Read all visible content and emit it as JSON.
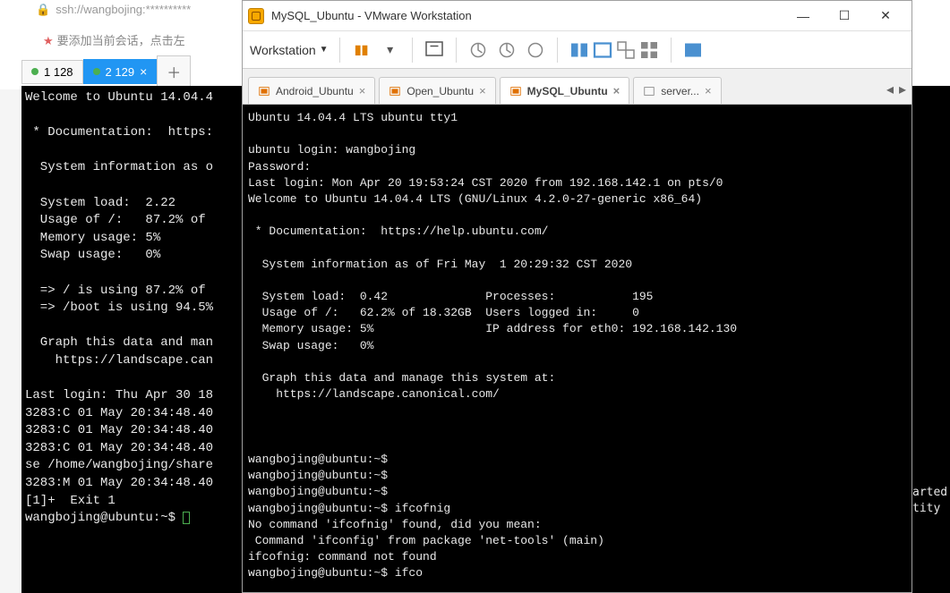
{
  "browser": {
    "address": "ssh://wangbojing:**********",
    "note": "要添加当前会话，点击左",
    "tabs": [
      {
        "label": "1 128"
      },
      {
        "label": "2 129"
      }
    ]
  },
  "left_terminal": {
    "lines": "Welcome to Ubuntu 14.04.4\n\n * Documentation:  https:\n\n  System information as o\n\n  System load:  2.22\n  Usage of /:   87.2% of \n  Memory usage: 5%\n  Swap usage:   0%\n\n  => / is using 87.2% of \n  => /boot is using 94.5%\n\n  Graph this data and man\n    https://landscape.can\n\nLast login: Thu Apr 30 18\n3283:C 01 May 20:34:48.40\n3283:C 01 May 20:34:48.40\n3283:C 01 May 20:34:48.40\nse /home/wangbojing/share\n3283:M 01 May 20:34:48.40\n[1]+  Exit 1\nwangbojing@ubuntu:~$ "
  },
  "right_terminal": {
    "lines": "arted\ntity"
  },
  "vmware": {
    "title": "MySQL_Ubuntu - VMware Workstation",
    "menu_label": "Workstation",
    "tabs": [
      {
        "label": "Android_Ubuntu"
      },
      {
        "label": "Open_Ubuntu"
      },
      {
        "label": "MySQL_Ubuntu"
      },
      {
        "label": "server..."
      }
    ],
    "terminal_lines": "Ubuntu 14.04.4 LTS ubuntu tty1\n\nubuntu login: wangbojing\nPassword:\nLast login: Mon Apr 20 19:53:24 CST 2020 from 192.168.142.1 on pts/0\nWelcome to Ubuntu 14.04.4 LTS (GNU/Linux 4.2.0-27-generic x86_64)\n\n * Documentation:  https://help.ubuntu.com/\n\n  System information as of Fri May  1 20:29:32 CST 2020\n\n  System load:  0.42              Processes:           195\n  Usage of /:   62.2% of 18.32GB  Users logged in:     0\n  Memory usage: 5%                IP address for eth0: 192.168.142.130\n  Swap usage:   0%\n\n  Graph this data and manage this system at:\n    https://landscape.canonical.com/\n\n\n\nwangbojing@ubuntu:~$\nwangbojing@ubuntu:~$\nwangbojing@ubuntu:~$\nwangbojing@ubuntu:~$ ifcofnig\nNo command 'ifcofnig' found, did you mean:\n Command 'ifconfig' from package 'net-tools' (main)\nifcofnig: command not found\nwangbojing@ubuntu:~$ ifco"
  }
}
